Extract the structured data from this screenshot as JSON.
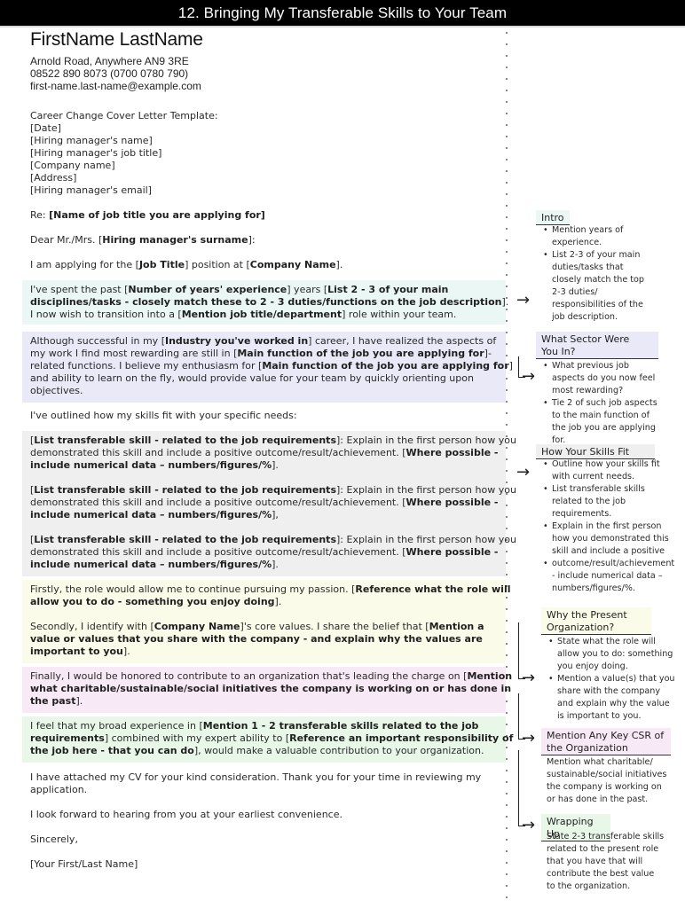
{
  "title": "12. Bringing My Transferable Skills to Your Team",
  "header": {
    "name": "FirstName LastName",
    "address": "Arnold Road, Anywhere AN9 3RE",
    "phone": "08522 890 8073 (0700 0780 790)",
    "email": "first-name.last-name@example.com"
  },
  "letter": {
    "template_label": "Career Change Cover Letter Template:",
    "recipient_lines": [
      "[Date]",
      "[Hiring manager's name]",
      "[Hiring manager's job title]",
      "[Company name]",
      "[Address]",
      "[Hiring manager's email]"
    ],
    "re_prefix": "Re: ",
    "re_bold": "[Name of job title you are applying for]",
    "greeting_prefix": "Dear Mr./Mrs. [",
    "greeting_bold": "Hiring manager's surname",
    "greeting_suffix": "]:",
    "applying": {
      "a": "I am applying for the [",
      "b": "Job Title",
      "c": "] position at [",
      "d": "Company Name",
      "e": "]."
    },
    "intro": {
      "l1a": "I've spent the past [",
      "l1b": "Number of years' experience",
      "l1c": "] years [",
      "l1d": "List 2 - 3 of your main",
      "l2a": "disciplines/tasks - closely match these to 2 - 3 duties/functions on the job description",
      "l2b": "].",
      "l3a": "I now wish to transition into a [",
      "l3b": "Mention job title/department",
      "l3c": "] role within your team."
    },
    "sector": {
      "l1a": "Although successful in my [",
      "l1b": "Industry you've worked in",
      "l1c": "] career, I have realized the aspects of",
      "l2a": "my work I find most rewarding are still in [",
      "l2b": "Main function of the job you are applying for",
      "l2c": "]-",
      "l3a": "related functions. I believe my enthusiasm for [",
      "l3b": "Main function of the job you are applying for",
      "l3c": "]",
      "l4": "and ability to learn on the fly, would provide value for your team by quickly orienting upon",
      "l5": "objectives."
    },
    "outline": "I've outlined how my skills fit with your specific needs:",
    "skills": [
      {
        "l1a": "[",
        "l1b": "List transferable skill - related to the job requirements",
        "l1c": "]: Explain in the first person how you",
        "l2a": "demonstrated this skill and include a positive outcome/result/achievement. [",
        "l2b": "Where possible -",
        "l3a": "include numerical data – numbers/figures/%",
        "l3b": "]."
      },
      {
        "l1a": "[",
        "l1b": "List transferable skill - related to the job requirements",
        "l1c": "]: Explain in the first person how you",
        "l2a": "demonstrated this skill and include a positive outcome/result/achievement. [",
        "l2b": "Where possible -",
        "l3a": "include numerical data – numbers/figures/%",
        "l3b": "],"
      },
      {
        "l1a": "[",
        "l1b": "List transferable skill - related to the job requirements",
        "l1c": "]: Explain in the first person how you",
        "l2a": "demonstrated this skill and include a positive outcome/result/achievement. [",
        "l2b": "Where possible -",
        "l3a": "include numerical data – numbers/figures/%",
        "l3b": "]."
      }
    ],
    "firstly": {
      "l1a": "Firstly, the role would allow me to continue pursuing my passion. [",
      "l1b": "Reference what the role will",
      "l2a": "allow you to do - something you enjoy doing",
      "l2b": "]."
    },
    "secondly": {
      "l1a": "Secondly, I identify with [",
      "l1b": "Company Name",
      "l1c": "]'s core values. I share the belief that [",
      "l1d": "Mention a",
      "l2": "value or values that you share with the company - and explain why the values are",
      "l3a": "important to you",
      "l3b": "]."
    },
    "finally": {
      "l1a": "Finally, I would be honored to contribute to an organization that's leading the charge on [",
      "l1b": "Mention",
      "l2": "what charitable/sustainable/social initiatives the company is working on or has done in",
      "l3a": "the past",
      "l3b": "]."
    },
    "closing_para": {
      "l1a": "I feel that my broad experience in [",
      "l1b": "Mention 1 - 2 transferable skills related to the job",
      "l2a": "requirements",
      "l2b": "] combined with my expert ability to [",
      "l2c": "Reference an important responsibility of",
      "l3a": "the job here - that you can do",
      "l3b": "], would make a valuable contribution to your organization."
    },
    "attached_l1": "I have attached my CV for your kind consideration. Thank you for your time in reviewing my",
    "attached_l2": "application.",
    "look_forward": "I look forward to hearing from you at your earliest convenience.",
    "signoff": "Sincerely,",
    "signature": "[Your First/Last Name]"
  },
  "sidebar": {
    "intro": {
      "heading": "Intro",
      "bullets": [
        [
          "Mention years of",
          "experience."
        ],
        [
          "List 2-3 of your main",
          "duties/tasks that",
          "closely match the top",
          "2-3 duties/",
          "responsibilities of the",
          "job description."
        ]
      ]
    },
    "sector": {
      "heading_l1": "What Sector Were",
      "heading_l2": "You In?",
      "bullets": [
        [
          "What previous job",
          "aspects do you now feel",
          "most rewarding?"
        ],
        [
          "Tie 2 of such job aspects",
          "to the main function of",
          "the job you are applying",
          "for."
        ]
      ]
    },
    "skills": {
      "heading": "How Your Skills Fit",
      "bullets": [
        [
          "Outline how your skills fit",
          "with current needs."
        ],
        [
          "List transferable skills",
          "related to the job",
          "requirements."
        ],
        [
          "Explain in the first person",
          "how you demonstrated this",
          "skill and include a positive"
        ],
        [
          "outcome/result/achievement",
          "- include numerical data –",
          "numbers/figures/%."
        ]
      ]
    },
    "why": {
      "heading_l1": "Why the Present",
      "heading_l2": "Organization?",
      "bullets": [
        [
          "State what the role will",
          "allow you to do: something",
          "you enjoy doing."
        ],
        [
          "Mention a value(s) that you",
          "share with the company",
          "and explain why the value",
          "is important to you."
        ]
      ]
    },
    "csr": {
      "heading_l1": "Mention Any Key CSR of",
      "heading_l2": "the Organization",
      "lines": [
        "Mention what charitable/",
        "sustainable/social initiatives",
        "the company is working on",
        "or has done in the past."
      ]
    },
    "wrap": {
      "heading": "Wrapping Up",
      "lines": [
        "State 2-3 transferable skills",
        "related to the present role",
        "that you have that will",
        "contribute the best value",
        "to the organization."
      ]
    }
  },
  "icons": {
    "arrow": "→"
  },
  "colors": {
    "teal": "#eaf7f5",
    "lavender": "#e9e9f7",
    "grey": "#efefef",
    "yellow": "#fbfbe9",
    "pink": "#f7e9f5",
    "green": "#e8f7e8"
  }
}
